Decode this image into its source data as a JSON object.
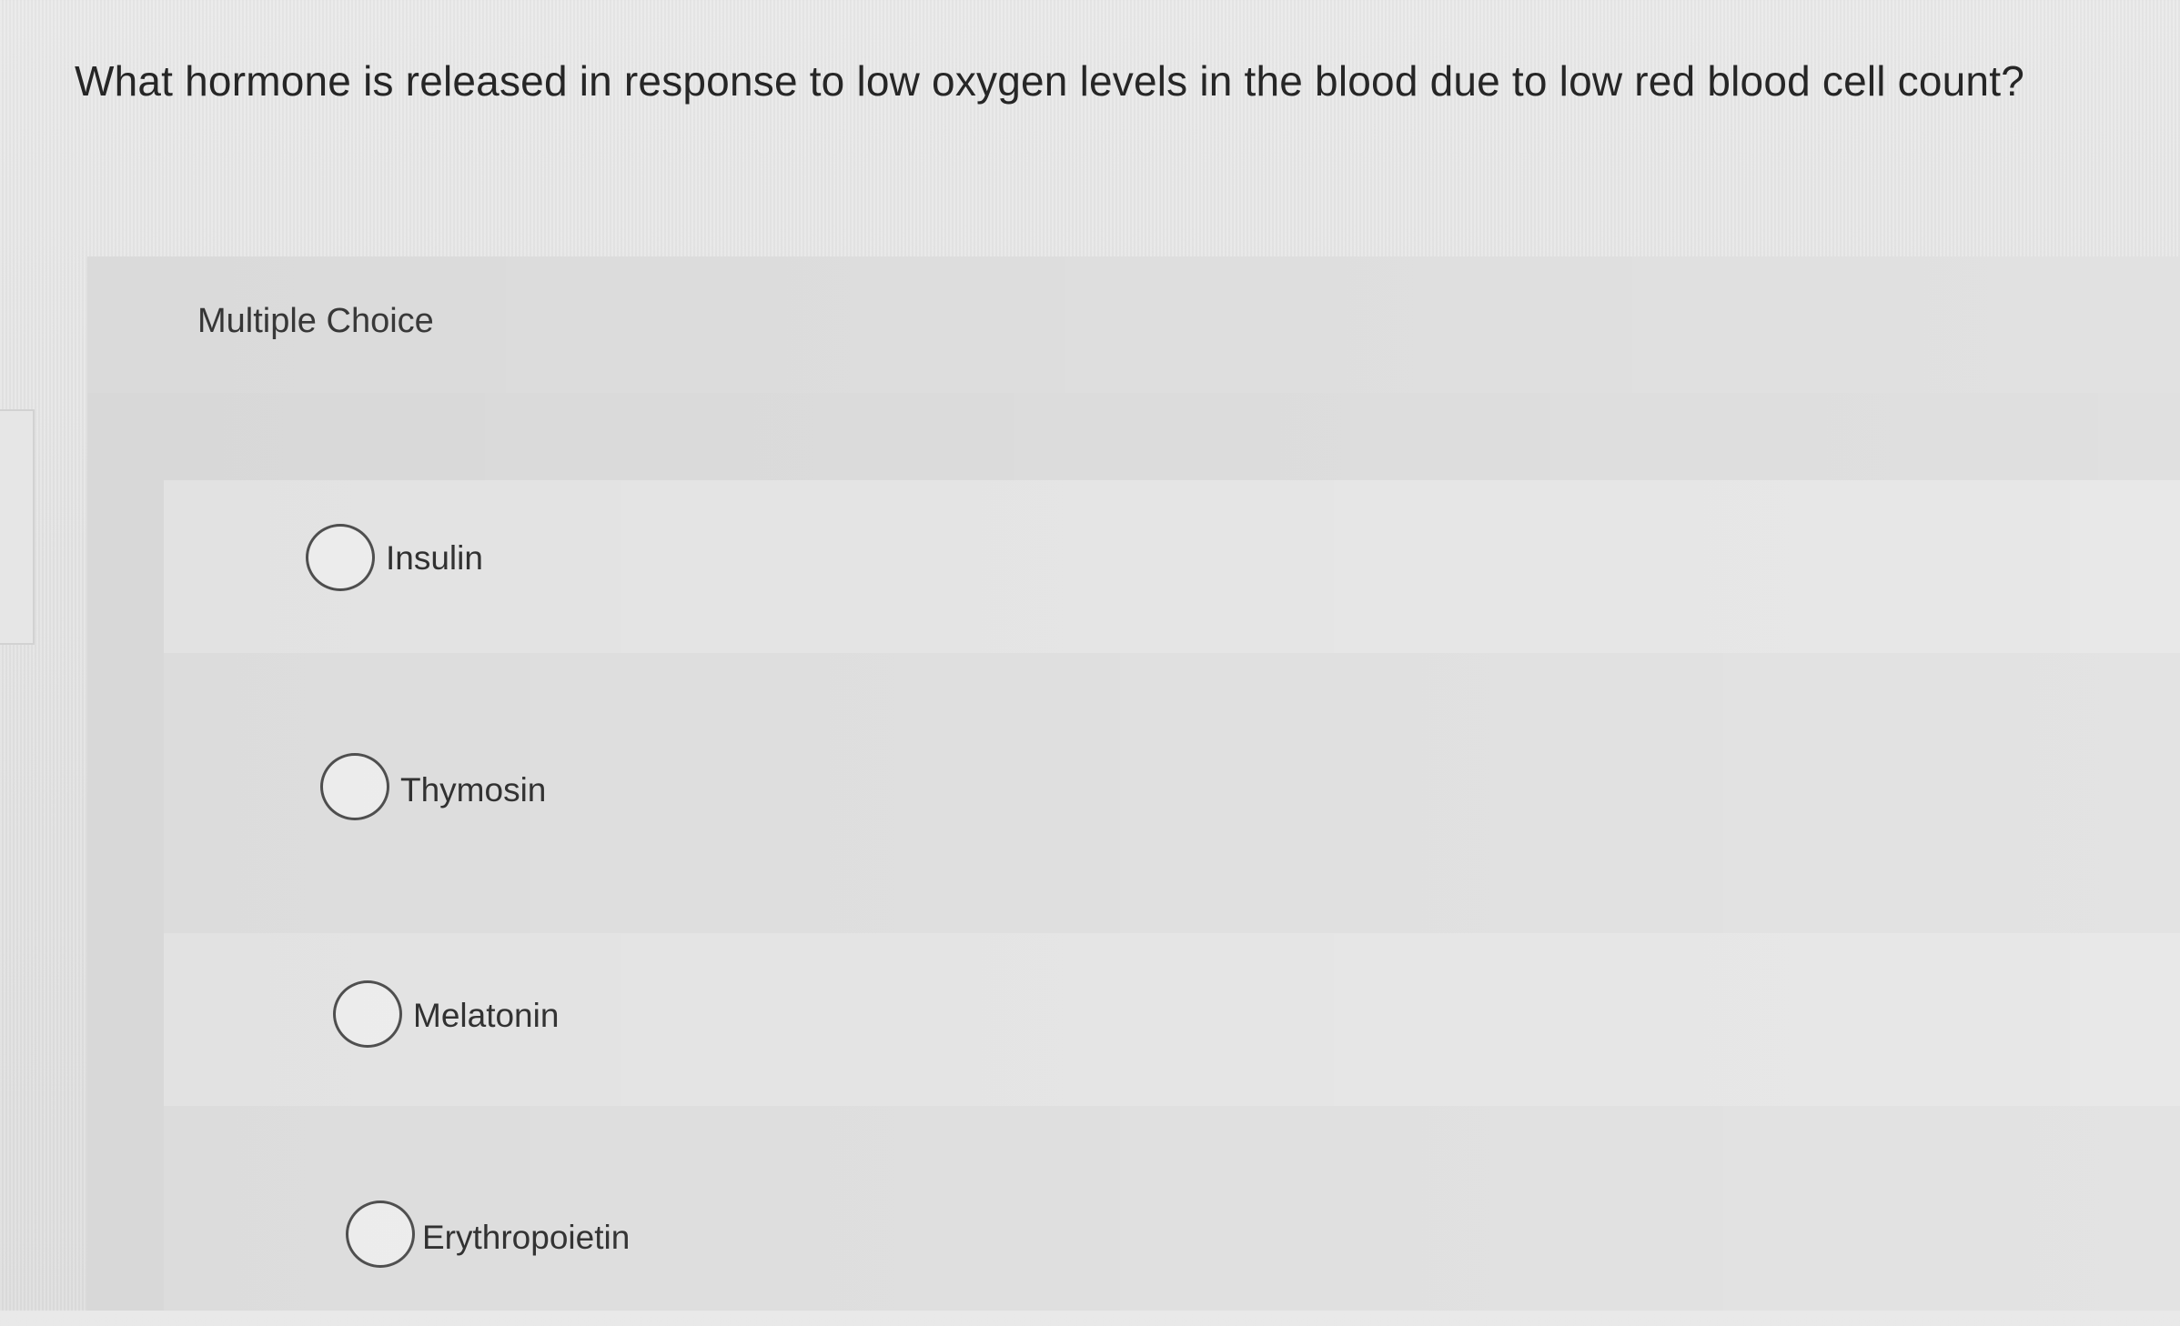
{
  "question": {
    "text": "What hormone is released in response to low oxygen levels in the blood due to low red blood cell count?"
  },
  "multiple_choice": {
    "label": "Multiple Choice",
    "options": [
      {
        "label": "Insulin",
        "selected": false
      },
      {
        "label": "Thymosin",
        "selected": false
      },
      {
        "label": "Melatonin",
        "selected": false
      },
      {
        "label": "Erythropoietin",
        "selected": false
      }
    ]
  }
}
